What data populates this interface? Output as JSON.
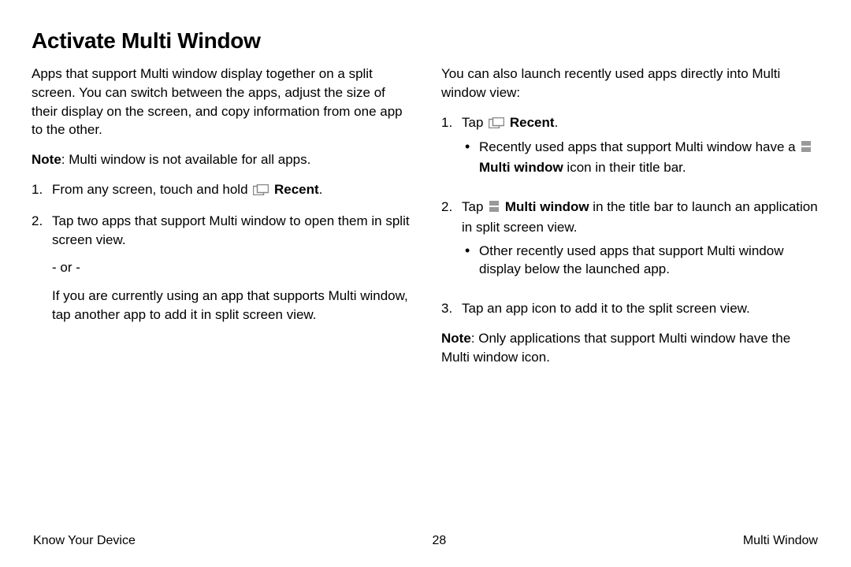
{
  "title": "Activate Multi Window",
  "left": {
    "intro": "Apps that support Multi window display together on a split screen. You can switch between the apps, adjust the size of their display on the screen, and copy information from one app to the other.",
    "note_label": "Note",
    "note_text": ": Multi window is not available for all apps.",
    "steps": [
      {
        "num": "1.",
        "pre": "From any screen, touch and hold ",
        "bold": "Recent",
        "post": "."
      },
      {
        "num": "2.",
        "text": "Tap two apps that support Multi window to open them in split screen view."
      }
    ],
    "or_text": "- or -",
    "alt_text": "If you are currently using an app that supports Multi window, tap another app to add it in split screen view."
  },
  "right": {
    "intro": "You can also launch recently used apps directly into Multi window view:",
    "steps": [
      {
        "num": "1.",
        "pre": "Tap ",
        "bold": "Recent",
        "post": ".",
        "bullets": [
          {
            "pre": "Recently used apps that support Multi window have a ",
            "bold": "Multi window",
            "post": " icon in their title bar."
          }
        ]
      },
      {
        "num": "2.",
        "pre": "Tap ",
        "bold": "Multi window",
        "post": " in the title bar to launch an application in split screen view.",
        "bullets": [
          {
            "text": "Other recently used apps that support Multi window display below the launched app."
          }
        ]
      },
      {
        "num": "3.",
        "text": "Tap an app icon to add it to the split screen view."
      }
    ],
    "note_label": "Note",
    "note_text": ": Only applications that support Multi window have the Multi window icon."
  },
  "footer": {
    "left": "Know Your Device",
    "center": "28",
    "right": "Multi Window"
  }
}
